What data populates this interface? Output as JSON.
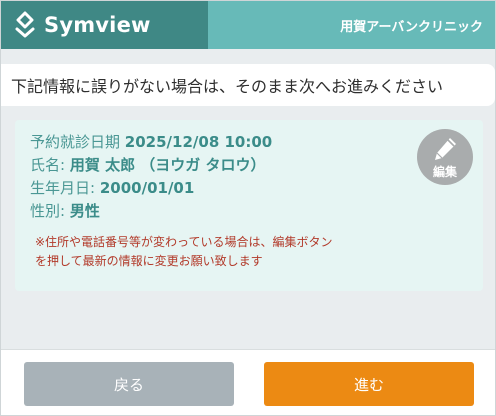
{
  "header": {
    "brand_name": "Symview",
    "clinic_name": "用賀アーバンクリニック"
  },
  "instruction": "下記情報に誤りがない場合は、そのまま次へお進みください",
  "patient": {
    "appointment_label": "予約就診日期",
    "appointment_value": "2025/12/08 10:00",
    "name_label": "氏名:",
    "name_value": "用賀 太郎 （ヨウガ タロウ）",
    "birth_label": "生年月日:",
    "birth_value": "2000/01/01",
    "gender_label": "性別:",
    "gender_value": "男性"
  },
  "notice_line1": "※住所や電話番号等が変わっている場合は、編集ボタン",
  "notice_line2": "を押して最新の情報に変更お願い致します",
  "edit_label": "編集",
  "buttons": {
    "back": "戻る",
    "next": "進む"
  },
  "colors": {
    "brand": "#3f8885",
    "header_accent": "#67bab8",
    "next_button": "#ec8a13",
    "back_button": "#a8b2b8",
    "notice_text": "#b23a2a"
  },
  "icons": [
    "logo-icon",
    "pencil-icon"
  ]
}
